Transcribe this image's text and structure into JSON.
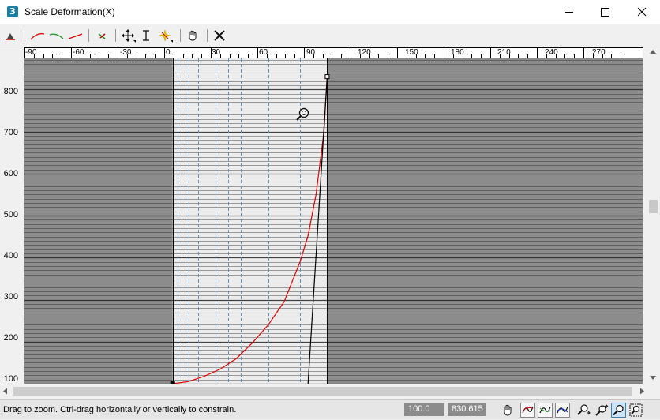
{
  "window": {
    "title": "Scale Deformation(X)",
    "app_badge": "3"
  },
  "ruler": {
    "labels": [
      "-90",
      "-60",
      "-30",
      "0",
      "30",
      "60",
      "90",
      "120",
      "150",
      "180",
      "210",
      "240",
      "270"
    ]
  },
  "yaxis": {
    "labels": [
      "800",
      "700",
      "600",
      "500",
      "400",
      "300",
      "200",
      "100"
    ]
  },
  "status": {
    "message": "Drag to zoom. Ctrl-drag horizontally or vertically to constrain.",
    "field1": "100.0",
    "field2": "830.615"
  },
  "colors": {
    "curve": "#e00000",
    "active_band": "#ececec",
    "outside_band": "#8c8c8c",
    "dashed_lines": "#5f8fb4"
  },
  "icons": [
    "insert-corner-point-icon",
    "curve-red-icon",
    "curve-green-icon",
    "curve-red-icon",
    "delete-point-icon",
    "move-icon",
    "scale-point-icon",
    "insert-bezier-icon",
    "hand-icon",
    "close-x-icon",
    "pan-hand-icon",
    "zoom-extents-icon",
    "zoom-horizontal-icon",
    "zoom-vertical-icon",
    "zoom-icon",
    "zoom-region-icon"
  ],
  "chart_data": {
    "type": "line",
    "x_range": [
      -93,
      295
    ],
    "y_range": [
      100,
      874
    ],
    "active_x_range": [
      0,
      97
    ],
    "series": [
      {
        "color": "#e00000",
        "points": [
          [
            0,
            100
          ],
          [
            10,
            105
          ],
          [
            20,
            118
          ],
          [
            30,
            135
          ],
          [
            40,
            160
          ],
          [
            50,
            197
          ],
          [
            60,
            240
          ],
          [
            70,
            295
          ],
          [
            80,
            390
          ],
          [
            85,
            452
          ],
          [
            90,
            550
          ],
          [
            95,
            700
          ],
          [
            97,
            830
          ]
        ]
      },
      {
        "color": "#000000",
        "points": [
          [
            85,
            100
          ],
          [
            97,
            830
          ]
        ]
      }
    ],
    "control_points": [
      [
        0,
        100
      ],
      [
        97,
        830.615
      ]
    ]
  }
}
